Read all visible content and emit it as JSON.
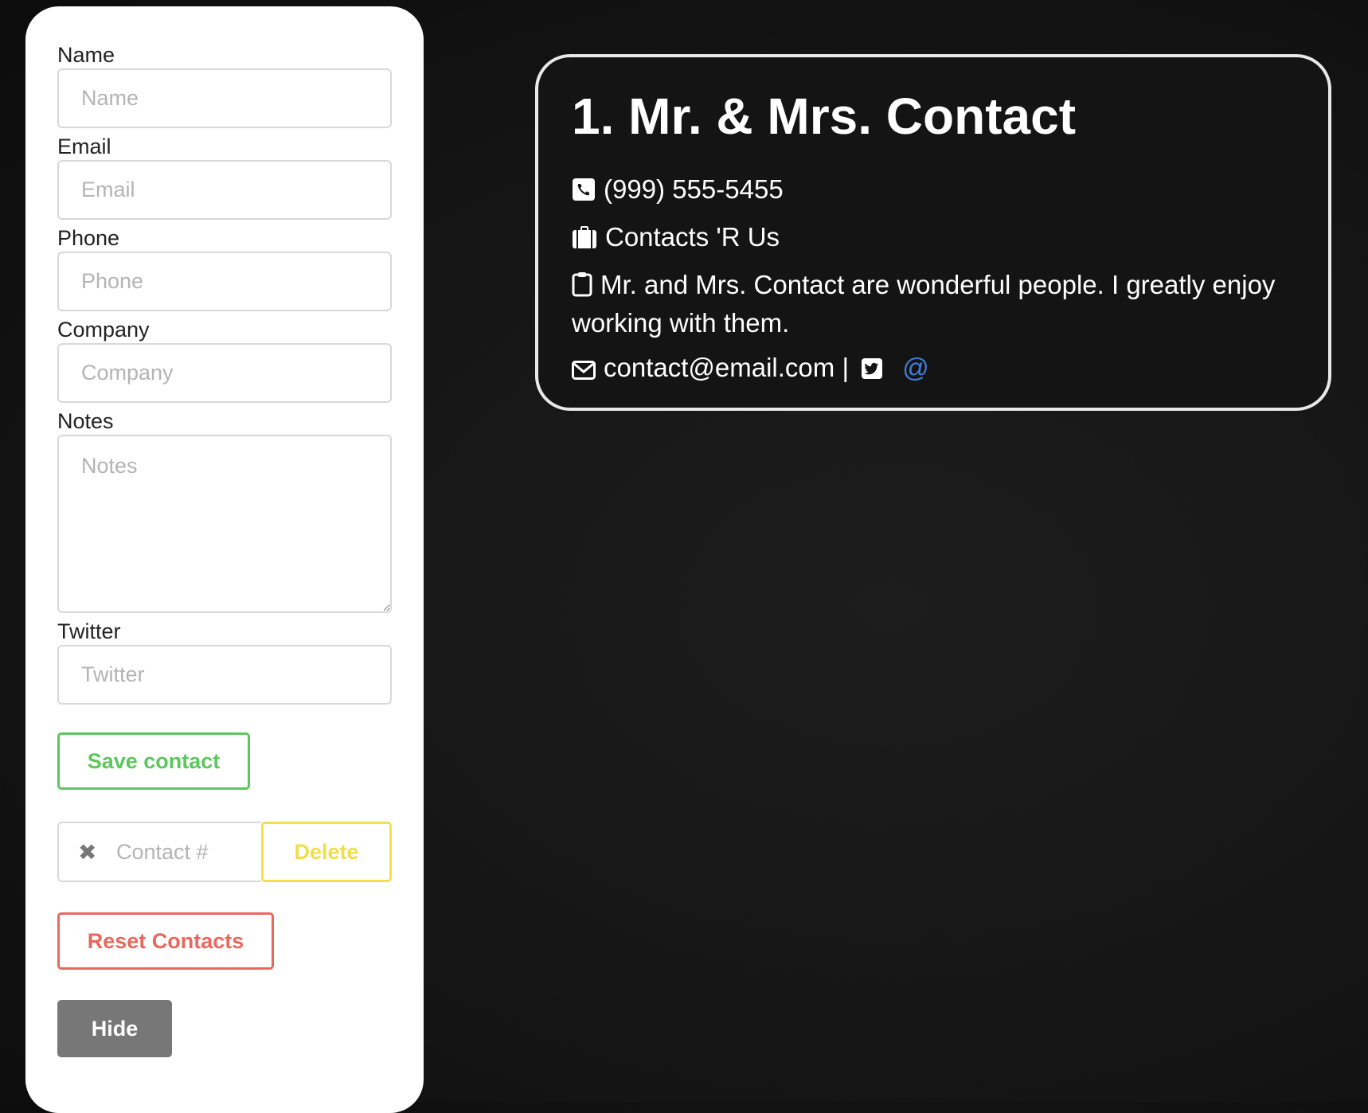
{
  "form": {
    "fields": {
      "name": {
        "label": "Name",
        "placeholder": "Name"
      },
      "email": {
        "label": "Email",
        "placeholder": "Email"
      },
      "phone": {
        "label": "Phone",
        "placeholder": "Phone"
      },
      "company": {
        "label": "Company",
        "placeholder": "Company"
      },
      "notes": {
        "label": "Notes",
        "placeholder": "Notes"
      },
      "twitter": {
        "label": "Twitter",
        "placeholder": "Twitter"
      }
    },
    "save_label": "Save contact",
    "contact_number_placeholder": "Contact #",
    "clear_icon": "✖",
    "delete_label": "Delete",
    "reset_label": "Reset Contacts",
    "hide_label": "Hide"
  },
  "contact": {
    "title": "1. Mr. & Mrs. Contact",
    "phone": "(999) 555-5455",
    "company": "Contacts 'R Us",
    "notes": "Mr. and Mrs. Contact are wonderful people. I greatly enjoy working with them.",
    "email": "contact@email.com",
    "separator": "|",
    "twitter_handle": "@"
  },
  "icons": {
    "phone": "phone-square-icon",
    "company": "briefcase-icon",
    "notes": "clipboard-icon",
    "email": "envelope-icon",
    "twitter": "twitter-square-icon",
    "clear": "times-icon"
  },
  "colors": {
    "save": "#5cc75c",
    "delete": "#f4e04a",
    "reset": "#e8685e",
    "hide": "#777777",
    "twitter_link": "#3b7fd8",
    "background": "#151515"
  }
}
